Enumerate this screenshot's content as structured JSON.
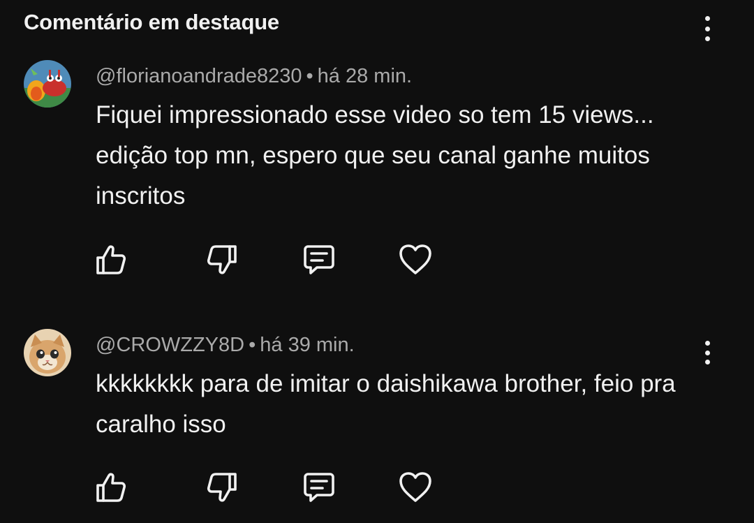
{
  "header": {
    "title": "Comentário em destaque",
    "menu_icon": "more-vertical-icon"
  },
  "comments": [
    {
      "author": "@florianoandrade8230",
      "separator": "•",
      "time": "há 28 min.",
      "text": "Fiquei impressionado esse video so tem 15 views... edição top mn, espero que seu canal ganhe muitos inscritos",
      "avatar": "cartoon-crab-avatar"
    },
    {
      "author": "@CROWZZY8D",
      "separator": "•",
      "time": "há 39 min.",
      "text": "kkkkkkkk para de imitar o daishikawa brother, feio pra caralho isso",
      "avatar": "kitten-avatar",
      "menu_icon": "more-vertical-icon"
    }
  ],
  "actions": {
    "like_icon": "thumbs-up-icon",
    "dislike_icon": "thumbs-down-icon",
    "reply_icon": "reply-comment-icon",
    "heart_icon": "heart-icon"
  },
  "colors": {
    "background": "#0f0f0f",
    "text_primary": "#f1f1f1",
    "text_secondary": "#aaaaaa"
  }
}
